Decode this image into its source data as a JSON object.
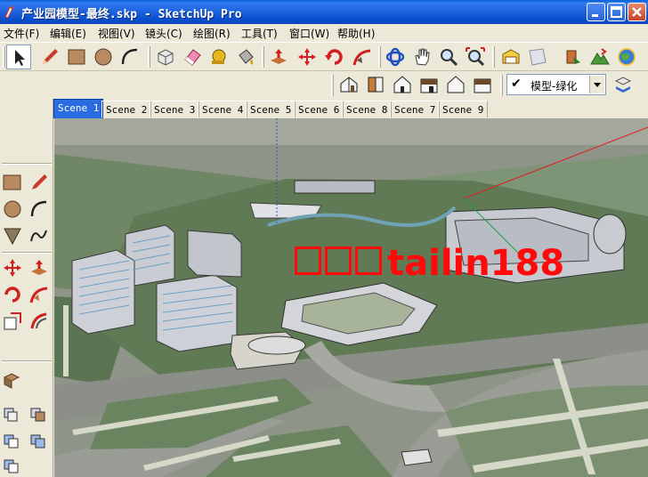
{
  "window": {
    "title": "产业园模型-最终.skp - SketchUp Pro"
  },
  "menu": {
    "items": [
      {
        "label": "文件(F)"
      },
      {
        "label": "编辑(E)"
      },
      {
        "label": "视图(V)"
      },
      {
        "label": "镜头(C)"
      },
      {
        "label": "绘图(R)"
      },
      {
        "label": "工具(T)"
      },
      {
        "label": "窗口(W)"
      },
      {
        "label": "帮助(H)"
      }
    ]
  },
  "toolbar": {
    "tools": [
      "select-arrow-icon",
      "pencil-line-icon",
      "rectangle-icon",
      "circle-icon",
      "arc-icon",
      "eraser-icon",
      "paint-bucket-icon",
      "tape-measure-icon",
      "push-pull-icon",
      "move-icon",
      "rotate-icon",
      "follow-me-icon",
      "orbit-icon",
      "pan-hand-icon",
      "zoom-icon",
      "zoom-extents-icon",
      "3d-warehouse-icon",
      "component-icon",
      "share-model-icon",
      "google-earth-icon"
    ],
    "views": [
      "iso-view-icon",
      "top-view-icon",
      "front-view-icon",
      "right-view-icon",
      "back-view-icon",
      "left-view-icon"
    ]
  },
  "layer": {
    "current": "模型-绿化"
  },
  "scenes": {
    "tabs": [
      {
        "label": "Scene 1",
        "active": true
      },
      {
        "label": "Scene 2"
      },
      {
        "label": "Scene 3"
      },
      {
        "label": "Scene 4"
      },
      {
        "label": "Scene 5"
      },
      {
        "label": "Scene 6"
      },
      {
        "label": "Scene 8"
      },
      {
        "label": "Scene 7"
      },
      {
        "label": "Scene 9"
      }
    ]
  },
  "viewport": {
    "watermark": "tailin188",
    "colors": {
      "ground": "#8f9488",
      "grass": "#5f7a54",
      "road": "#9a9d96",
      "building": "#cfd0d4",
      "red_axis": "#e02020",
      "watermark": "#ff0a0a"
    }
  }
}
